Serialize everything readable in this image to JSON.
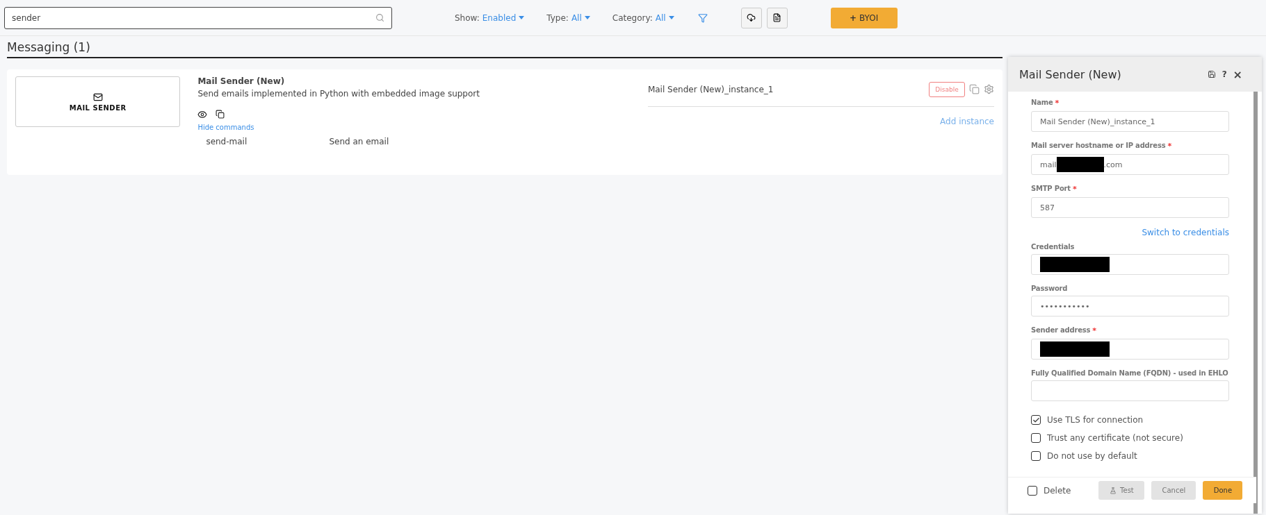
{
  "search": {
    "value": "sender"
  },
  "filters": [
    {
      "label": "Show:",
      "value": "Enabled"
    },
    {
      "label": "Type:",
      "value": "All"
    },
    {
      "label": "Category:",
      "value": "All"
    }
  ],
  "byoi_button": {
    "icon": "+",
    "label": "BYOI"
  },
  "section": {
    "title": "Messaging (1)"
  },
  "integration": {
    "logo_text": "MAIL SENDER",
    "name": "Mail Sender (New)",
    "description": "Send emails implemented in Python with embedded image support",
    "hide_commands": "Hide commands",
    "commands": [
      {
        "name": "send-mail",
        "description": "Send an email"
      }
    ],
    "instance": "Mail Sender (New)_instance_1",
    "disable_button": "Disable",
    "add_instance": "Add instance"
  },
  "panel": {
    "title": "Mail Sender (New)",
    "help": "?",
    "close": "×",
    "fields": [
      {
        "kind": "text",
        "label": "Name",
        "required_mark": "*",
        "value": "Mail Sender (New)_instance_1"
      },
      {
        "kind": "redacted",
        "label": "Mail server hostname or IP address",
        "required_mark": "*",
        "prefix": "mail",
        "suffix": ".com"
      },
      {
        "kind": "text",
        "label": "SMTP Port",
        "required_mark": "*",
        "value": "587"
      },
      {
        "kind": "link",
        "label": "Switch to credentials"
      },
      {
        "kind": "redacted",
        "label": "Credentials"
      },
      {
        "kind": "password",
        "label": "Password",
        "value": "•••••••••••"
      },
      {
        "kind": "redacted",
        "label": "Sender address",
        "required_mark": "*"
      },
      {
        "kind": "text",
        "label": "Fully Qualified Domain Name (FQDN) - used in EHLO"
      }
    ],
    "checkboxes": [
      {
        "label": "Use TLS for connection",
        "checked": true
      },
      {
        "label": "Trust any certificate (not secure)",
        "checked": false
      },
      {
        "label": "Do not use by default",
        "checked": false
      }
    ],
    "footer": {
      "delete": {
        "label": "Delete",
        "checked": false
      },
      "test": "Test",
      "cancel": "Cancel",
      "done": "Done"
    }
  }
}
